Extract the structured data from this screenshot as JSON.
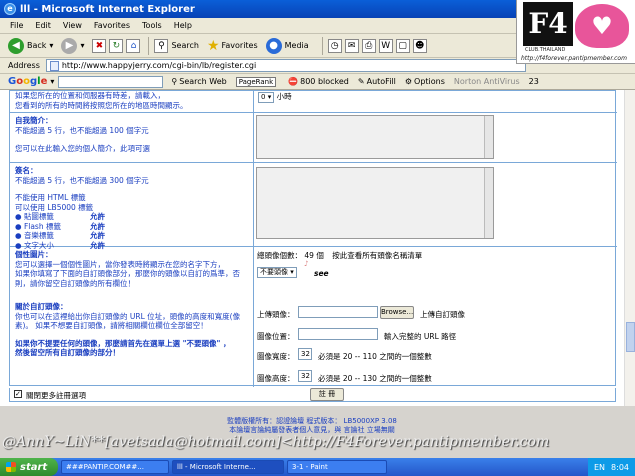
{
  "window": {
    "title": "lll - Microsoft Internet Explorer"
  },
  "menu": [
    "File",
    "Edit",
    "View",
    "Favorites",
    "Tools",
    "Help"
  ],
  "toolbar": {
    "back": "Back",
    "search": "Search",
    "favorites": "Favorites",
    "media": "Media"
  },
  "address": {
    "label": "Address",
    "url": "http://www.happyjerry.com/cgi-bin/lb/register.cgi"
  },
  "googlebar": {
    "logo": "Google",
    "search_web": "Search Web",
    "pagerank": "PageRank",
    "blocked": "800 blocked",
    "autofill": "AutoFill",
    "options": "Options",
    "norton": "Norton AntiVirus",
    "count": "23"
  },
  "timezone": {
    "line1": "如果您所在的位置和伺服器有時差，請載入，",
    "line2": "您看到的所有的時間將按照您所在的地區時間顯示。",
    "select_value": "0",
    "unit": "小時"
  },
  "intro": {
    "heading": "自我簡介：",
    "line1": "不能超過 5 行，也不能超過 100 個字元",
    "line2": "您可以在此輸入您的個人簡介，此項可選"
  },
  "signature": {
    "heading": "簽名：",
    "line1": "不能超過 5 行，也不能超過 300 個字元",
    "line2": "不能使用 HTML 標籤",
    "line3": "可以使用 LB5000 標籤",
    "items": [
      {
        "name": "貼圖標籤",
        "value": "允許"
      },
      {
        "name": "Flash 標籤",
        "value": "允許"
      },
      {
        "name": "音樂標籤",
        "value": "允許"
      },
      {
        "name": "文字大小",
        "value": "允許"
      }
    ]
  },
  "avatar": {
    "heading": "個性圖片：",
    "desc1": "您可以選擇一個個性圖片，當你發表時將顯示在您的名字下方，",
    "desc2": "如果你填寫了下面的自訂頭像部分，那麼你的頭像以自訂的爲準，否",
    "desc3": "則，請你留空自訂頭像的所有欄位！",
    "count_label": "總頭像個數：",
    "count_value": "49",
    "count_unit": "個",
    "view_all": "按此查看所有頭像名稱清單",
    "select_value": "不要頭像",
    "sample_caption": "see",
    "custom_heading": "關於自訂頭像：",
    "custom1": "你也可以在這裡給出你自訂頭像的 URL 位址，頭像的高度和寬度(像",
    "custom2": "素)。 如果不想要自訂頭像，請將相關欄位欄位全部留空！",
    "warn1": "如果你不提要任何的頭像，那麼請首先在選單上選 \"不要頭像\" ，",
    "warn2": "然後留空所有自訂頭像的部分！",
    "upload_label": "上傳頭像：",
    "browse": "Browse...",
    "upload_note": "上傳自訂頭像",
    "pos_label": "圖像位置：",
    "pos_note": "輸入完整的 URL 路徑",
    "width_label": "圖像寬度：",
    "width_value": "32",
    "width_note": "必須是 20 -- 110 之間的一個整數",
    "height_label": "圖像高度：",
    "height_value": "32",
    "height_note": "必須是 20 -- 130 之間的一個整數"
  },
  "more_options": "關閉更多註冊選項",
  "submit": "註 冊",
  "footer": {
    "line1": "監體版權所有：認證論壇   程式版本： LB5000XP 3.08",
    "line2": "本論壇言論純屬發表者個人意見，與 言論社 立場無關"
  },
  "watermark": "@AnnY~LiN**[avetsada@hotmail.com]<http://F4Forever.pantipmember.com",
  "logo": {
    "text": "F4",
    "sub": "CLUB.THAILAND",
    "url": "http://f4forever.pantipmember.com"
  },
  "taskbar": {
    "start": "start",
    "tasks": [
      "###PANTIP.COM##...",
      "lll - Microsoft Interne...",
      "3-1 - Paint"
    ],
    "lang": "EN",
    "clock": "8:04"
  }
}
